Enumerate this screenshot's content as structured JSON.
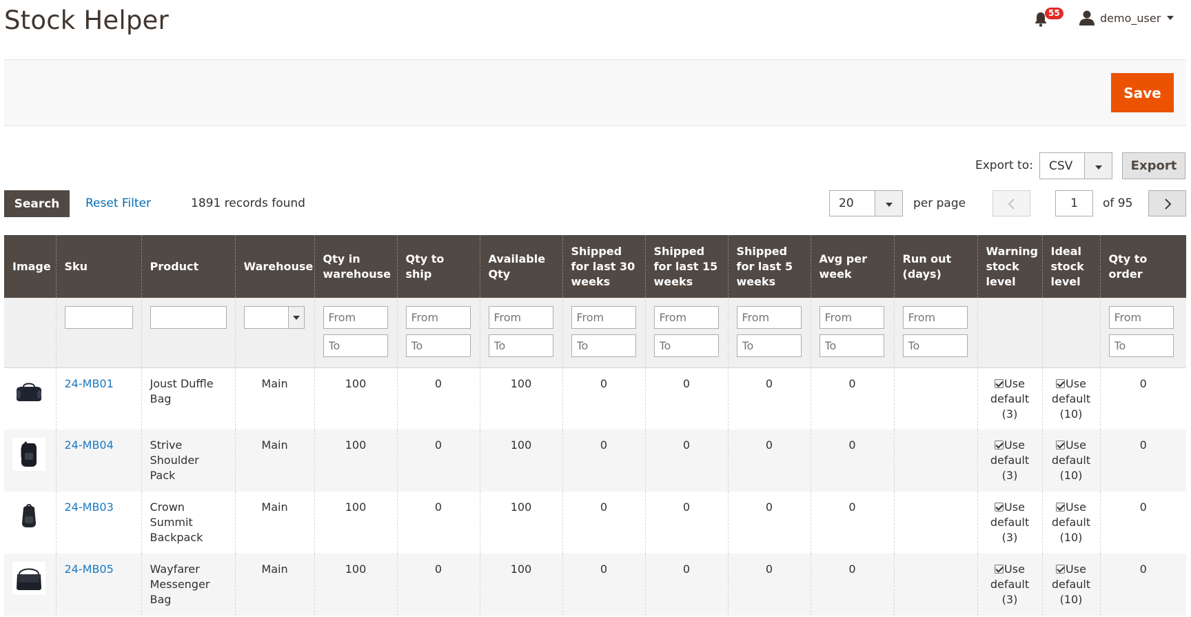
{
  "page": {
    "title": "Stock Helper"
  },
  "header": {
    "notifications_count": "55",
    "user_name": "demo_user"
  },
  "actions": {
    "save_label": "Save"
  },
  "export": {
    "label": "Export to:",
    "format": "CSV",
    "button_label": "Export"
  },
  "toolbar": {
    "search_label": "Search",
    "reset_label": "Reset Filter",
    "records_found": "1891 records found",
    "per_page_value": "20",
    "per_page_label": "per page",
    "current_page": "1",
    "total_pages_label": "of 95"
  },
  "grid": {
    "columns": [
      "Image",
      "Sku",
      "Product",
      "Warehouse",
      "Qty in warehouse",
      "Qty to ship",
      "Available Qty",
      "Shipped for last 30 weeks",
      "Shipped for last 15 weeks",
      "Shipped for last 5 weeks",
      "Avg per week",
      "Run out (days)",
      "Warning stock level",
      "Ideal stock level",
      "Qty to order"
    ],
    "filter_from_placeholder": "From",
    "filter_to_placeholder": "To",
    "rows": [
      {
        "sku": "24-MB01",
        "product": "Joust Duffle Bag",
        "warehouse": "Main",
        "qty_in_warehouse": "100",
        "qty_to_ship": "0",
        "available_qty": "100",
        "shipped_30": "0",
        "shipped_15": "0",
        "shipped_5": "0",
        "avg_per_week": "0",
        "run_out": "",
        "warning_default": "Use default (3)",
        "ideal_default": "Use default (10)",
        "qty_to_order": "0"
      },
      {
        "sku": "24-MB04",
        "product": "Strive Shoulder Pack",
        "warehouse": "Main",
        "qty_in_warehouse": "100",
        "qty_to_ship": "0",
        "available_qty": "100",
        "shipped_30": "0",
        "shipped_15": "0",
        "shipped_5": "0",
        "avg_per_week": "0",
        "run_out": "",
        "warning_default": "Use default (3)",
        "ideal_default": "Use default (10)",
        "qty_to_order": "0"
      },
      {
        "sku": "24-MB03",
        "product": "Crown Summit Backpack",
        "warehouse": "Main",
        "qty_in_warehouse": "100",
        "qty_to_ship": "0",
        "available_qty": "100",
        "shipped_30": "0",
        "shipped_15": "0",
        "shipped_5": "0",
        "avg_per_week": "0",
        "run_out": "",
        "warning_default": "Use default (3)",
        "ideal_default": "Use default (10)",
        "qty_to_order": "0"
      },
      {
        "sku": "24-MB05",
        "product": "Wayfarer Messenger Bag",
        "warehouse": "Main",
        "qty_in_warehouse": "100",
        "qty_to_ship": "0",
        "available_qty": "100",
        "shipped_30": "0",
        "shipped_15": "0",
        "shipped_5": "0",
        "avg_per_week": "0",
        "run_out": "",
        "warning_default": "Use default (3)",
        "ideal_default": "Use default (10)",
        "qty_to_order": "0"
      }
    ]
  },
  "colors": {
    "accent": "#eb5202",
    "header_bg": "#514943",
    "link": "#1979c3"
  }
}
